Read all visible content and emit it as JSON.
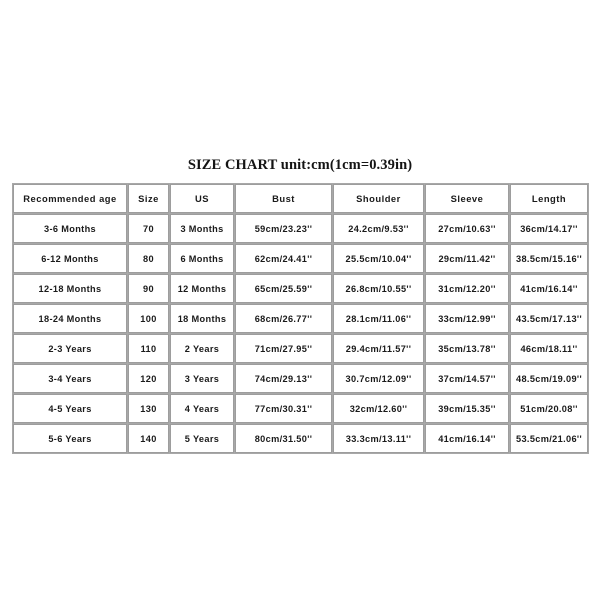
{
  "title": "SIZE CHART unit:cm(1cm=0.39in)",
  "table": {
    "headers": [
      "Recommended age",
      "Size",
      "US",
      "Bust",
      "Shoulder",
      "Sleeve",
      "Length"
    ],
    "rows": [
      [
        "3-6 Months",
        "70",
        "3 Months",
        "59cm/23.23''",
        "24.2cm/9.53''",
        "27cm/10.63''",
        "36cm/14.17''"
      ],
      [
        "6-12 Months",
        "80",
        "6 Months",
        "62cm/24.41''",
        "25.5cm/10.04''",
        "29cm/11.42''",
        "38.5cm/15.16''"
      ],
      [
        "12-18 Months",
        "90",
        "12 Months",
        "65cm/25.59''",
        "26.8cm/10.55''",
        "31cm/12.20''",
        "41cm/16.14''"
      ],
      [
        "18-24 Months",
        "100",
        "18 Months",
        "68cm/26.77''",
        "28.1cm/11.06''",
        "33cm/12.99''",
        "43.5cm/17.13''"
      ],
      [
        "2-3 Years",
        "110",
        "2 Years",
        "71cm/27.95''",
        "29.4cm/11.57''",
        "35cm/13.78''",
        "46cm/18.11''"
      ],
      [
        "3-4 Years",
        "120",
        "3 Years",
        "74cm/29.13''",
        "30.7cm/12.09''",
        "37cm/14.57''",
        "48.5cm/19.09''"
      ],
      [
        "4-5 Years",
        "130",
        "4 Years",
        "77cm/30.31''",
        "32cm/12.60''",
        "39cm/15.35''",
        "51cm/20.08''"
      ],
      [
        "5-6 Years",
        "140",
        "5 Years",
        "80cm/31.50''",
        "33.3cm/13.11''",
        "41cm/16.14''",
        "53.5cm/21.06''"
      ]
    ]
  },
  "chart_data": {
    "type": "table",
    "title": "SIZE CHART unit:cm(1cm=0.39in)",
    "columns": [
      "Recommended age",
      "Size",
      "US",
      "Bust",
      "Shoulder",
      "Sleeve",
      "Length"
    ],
    "units": {
      "cm_to_in": 0.39,
      "bust": "cm/in",
      "shoulder": "cm/in",
      "sleeve": "cm/in",
      "length": "cm/in"
    },
    "rows": [
      {
        "recommended_age": "3-6 Months",
        "size": 70,
        "us": "3 Months",
        "bust_cm": 59,
        "bust_in": 23.23,
        "shoulder_cm": 24.2,
        "shoulder_in": 9.53,
        "sleeve_cm": 27,
        "sleeve_in": 10.63,
        "length_cm": 36,
        "length_in": 14.17
      },
      {
        "recommended_age": "6-12 Months",
        "size": 80,
        "us": "6 Months",
        "bust_cm": 62,
        "bust_in": 24.41,
        "shoulder_cm": 25.5,
        "shoulder_in": 10.04,
        "sleeve_cm": 29,
        "sleeve_in": 11.42,
        "length_cm": 38.5,
        "length_in": 15.16
      },
      {
        "recommended_age": "12-18 Months",
        "size": 90,
        "us": "12 Months",
        "bust_cm": 65,
        "bust_in": 25.59,
        "shoulder_cm": 26.8,
        "shoulder_in": 10.55,
        "sleeve_cm": 31,
        "sleeve_in": 12.2,
        "length_cm": 41,
        "length_in": 16.14
      },
      {
        "recommended_age": "18-24 Months",
        "size": 100,
        "us": "18 Months",
        "bust_cm": 68,
        "bust_in": 26.77,
        "shoulder_cm": 28.1,
        "shoulder_in": 11.06,
        "sleeve_cm": 33,
        "sleeve_in": 12.99,
        "length_cm": 43.5,
        "length_in": 17.13
      },
      {
        "recommended_age": "2-3 Years",
        "size": 110,
        "us": "2 Years",
        "bust_cm": 71,
        "bust_in": 27.95,
        "shoulder_cm": 29.4,
        "shoulder_in": 11.57,
        "sleeve_cm": 35,
        "sleeve_in": 13.78,
        "length_cm": 46,
        "length_in": 18.11
      },
      {
        "recommended_age": "3-4 Years",
        "size": 120,
        "us": "3 Years",
        "bust_cm": 74,
        "bust_in": 29.13,
        "shoulder_cm": 30.7,
        "shoulder_in": 12.09,
        "sleeve_cm": 37,
        "sleeve_in": 14.57,
        "length_cm": 48.5,
        "length_in": 19.09
      },
      {
        "recommended_age": "4-5 Years",
        "size": 130,
        "us": "4 Years",
        "bust_cm": 77,
        "bust_in": 30.31,
        "shoulder_cm": 32,
        "shoulder_in": 12.6,
        "sleeve_cm": 39,
        "sleeve_in": 15.35,
        "length_cm": 51,
        "length_in": 20.08
      },
      {
        "recommended_age": "5-6 Years",
        "size": 140,
        "us": "5 Years",
        "bust_cm": 80,
        "bust_in": 31.5,
        "shoulder_cm": 33.3,
        "shoulder_in": 13.11,
        "sleeve_cm": 41,
        "sleeve_in": 16.14,
        "length_cm": 53.5,
        "length_in": 21.06
      }
    ]
  },
  "colors": {
    "background": "#ffffff",
    "text": "#1a1a1a",
    "border": "#9d9d9d"
  }
}
